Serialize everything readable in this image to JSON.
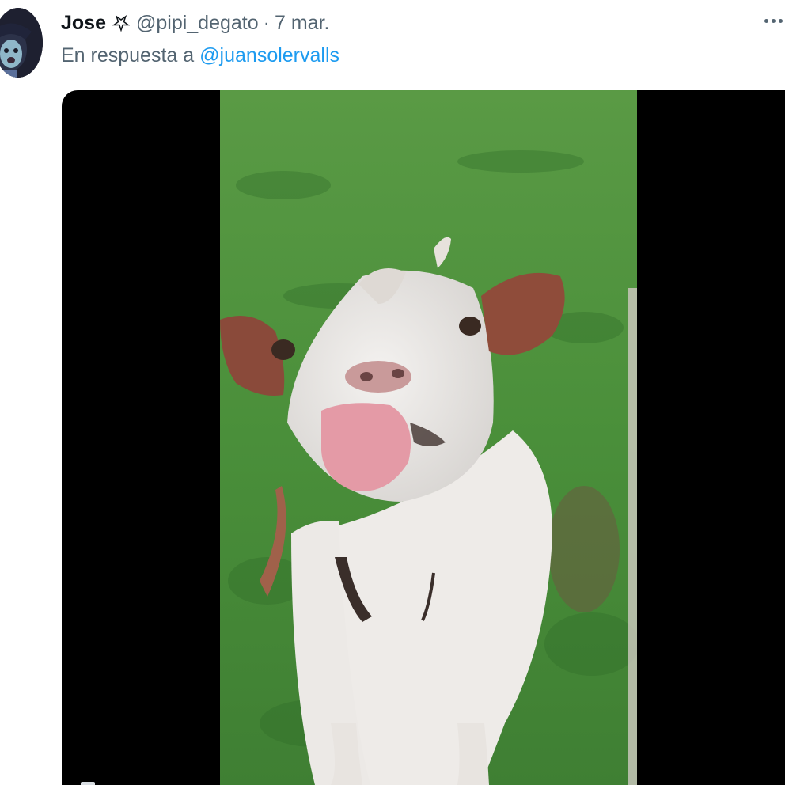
{
  "tweet": {
    "author_name": "Jose",
    "author_handle": "@pipi_degato",
    "separator": "·",
    "timestamp": "7 mar.",
    "reply_prefix": "En respuesta a",
    "reply_to": "@juansolervalls"
  },
  "media": {
    "type": "video",
    "subject": "goat"
  },
  "colors": {
    "name_text": "#0f1419",
    "secondary_text": "#536471",
    "link": "#1d9bf0",
    "media_background": "#000000",
    "grass": "#4a8f3a"
  },
  "icons": {
    "badge": "pentagram-icon",
    "more": "more-icon"
  }
}
